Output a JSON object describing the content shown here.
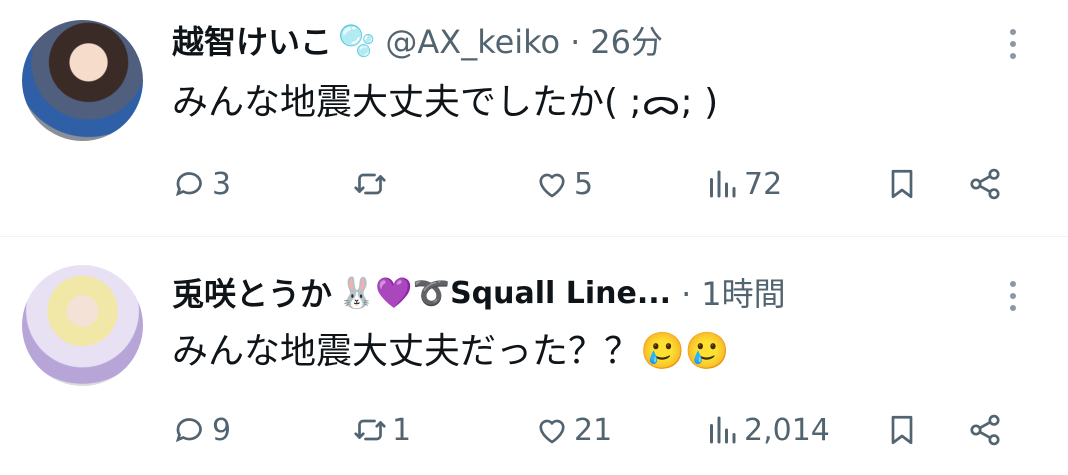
{
  "tweets": [
    {
      "name": "越智けいこ",
      "name_emoji": "🫧",
      "handle": "@AX_keiko",
      "separator": "·",
      "time": "26分",
      "text": "みんな地震大丈夫でしたか( ;ᯅ; )",
      "replies": "3",
      "retweets": "",
      "likes": "5",
      "views": "72"
    },
    {
      "name": "兎咲とうか",
      "name_emoji": "🐰💜➰Squall Line...",
      "handle": "",
      "separator": "·",
      "time": "1時間",
      "text": "みんな地震大丈夫だった？？🥲🥲",
      "replies": "9",
      "retweets": "1",
      "likes": "21",
      "views": "2,014"
    }
  ],
  "icons": {
    "reply": "reply-icon",
    "retweet": "retweet-icon",
    "like": "heart-icon",
    "views": "views-icon",
    "bookmark": "bookmark-icon",
    "share": "share-icon",
    "more": "more-icon"
  },
  "colors": {
    "text": "#0f1419",
    "secondary": "#536471",
    "divider": "#eff3f4"
  }
}
